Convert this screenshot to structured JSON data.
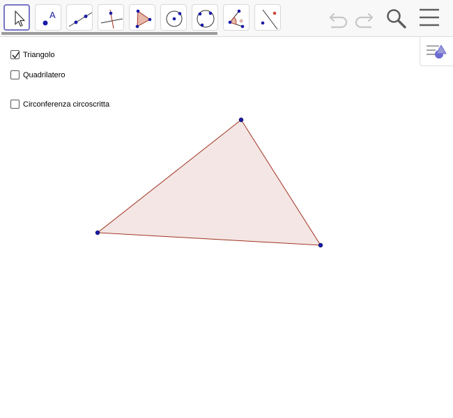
{
  "toolbar": {
    "tools": [
      {
        "name": "move-tool",
        "selected": true
      },
      {
        "name": "point-tool",
        "icon_letter": "A"
      },
      {
        "name": "line-tool"
      },
      {
        "name": "perpendicular-line-tool"
      },
      {
        "name": "polygon-tool"
      },
      {
        "name": "circle-center-point-tool"
      },
      {
        "name": "circle-three-points-tool"
      },
      {
        "name": "angle-tool",
        "icon_letter": "α"
      },
      {
        "name": "reflect-tool"
      }
    ],
    "undo_icon": "undo-icon",
    "redo_icon": "redo-icon",
    "search_icon": "search-icon",
    "menu_icon": "hamburger-menu-icon"
  },
  "style_bar_toggle_icon": "style-bar-icon",
  "checkboxes": [
    {
      "label": "Triangolo",
      "checked": true
    },
    {
      "label": "Quadrilatero",
      "checked": false
    },
    {
      "label": "Circonferenza circoscritta",
      "checked": false
    }
  ],
  "triangle": {
    "fill_color": "#f3e6e4",
    "stroke_color": "#a0311f",
    "point_color": "#1a1aa6"
  },
  "colors": {
    "accent": "#7775c8",
    "icon_dark": "#5e5e5e",
    "icon_light": "#c7c7c7"
  }
}
